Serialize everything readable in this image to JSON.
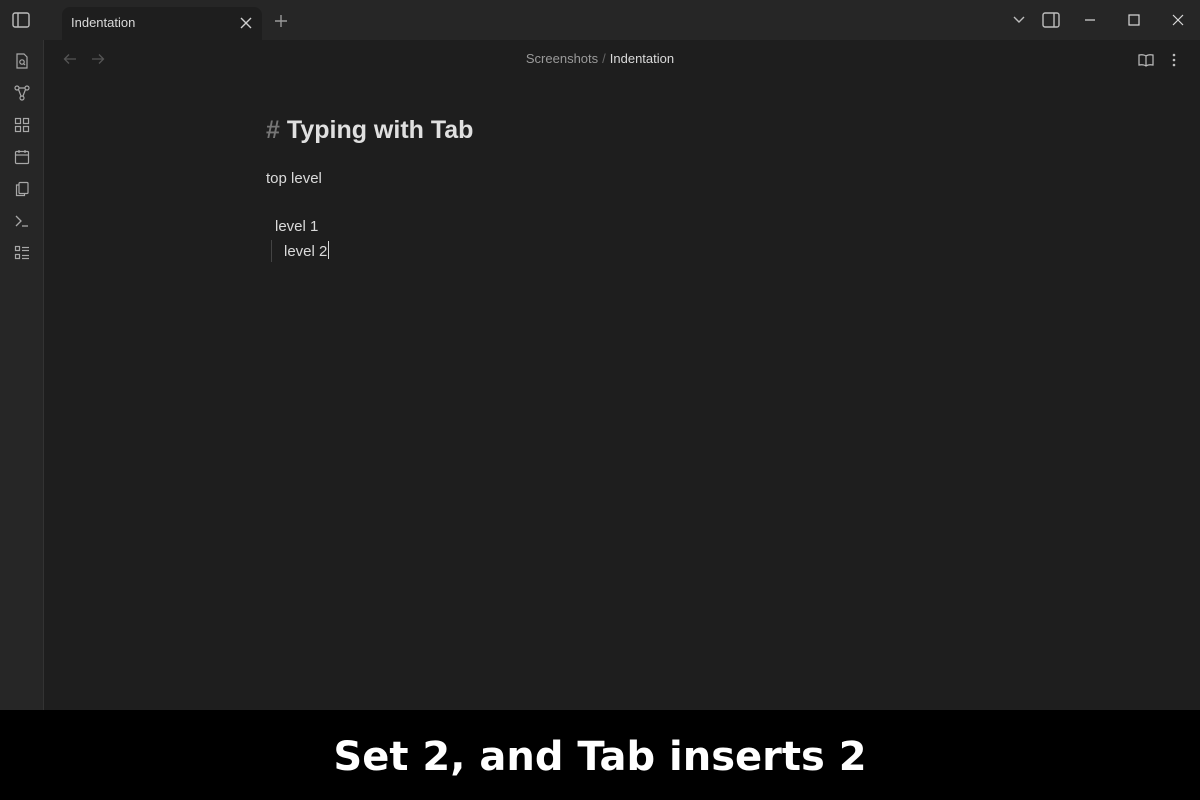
{
  "colors": {
    "background": "#1e1e1e",
    "titlebar": "#262626",
    "text": "#dadada",
    "muted": "#9a9a9a",
    "caption_bg": "#000000"
  },
  "titlebar": {
    "tab": {
      "title": "Indentation",
      "close_icon": "close-icon"
    },
    "new_tab_icon": "plus-icon",
    "window_controls": [
      "chevron-down-icon",
      "sidebar-right-icon",
      "minimize-icon",
      "maximize-icon",
      "close-icon"
    ]
  },
  "sidebar": {
    "icons": [
      "file-search-icon",
      "graph-icon",
      "canvas-icon",
      "calendar-icon",
      "copy-icon",
      "terminal-icon",
      "list-icon"
    ]
  },
  "header": {
    "breadcrumb": {
      "folder": "Screenshots",
      "separator": "/",
      "file": "Indentation"
    },
    "actions": [
      "reading-view-icon",
      "more-options-icon"
    ]
  },
  "editor": {
    "heading_marker": "#",
    "heading": "Typing with Tab",
    "lines": [
      "top level",
      "level 1",
      "level 2"
    ]
  },
  "caption": "Set 2, and Tab inserts 2"
}
